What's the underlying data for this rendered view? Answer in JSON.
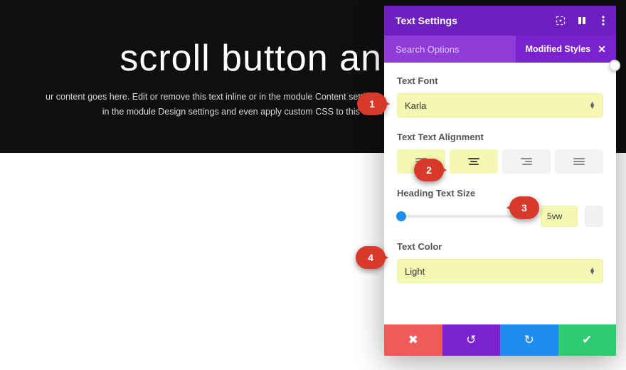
{
  "hero": {
    "title": "scroll button animation",
    "body": "ur content goes here. Edit or remove this text inline or in the module Content settings. You can also style every aspect of this content in the module Design settings and even apply custom CSS to this text in the module Advanced settings."
  },
  "panel": {
    "title": "Text Settings",
    "search_label": "Search Options",
    "modified_label": "Modified Styles"
  },
  "fields": {
    "font": {
      "label": "Text Font",
      "value": "Karla"
    },
    "align": {
      "label": "Text Text Alignment"
    },
    "size": {
      "label": "Heading Text Size",
      "value": "5vw"
    },
    "color": {
      "label": "Text Color",
      "value": "Light"
    }
  },
  "badges": {
    "b1": "1",
    "b2": "2",
    "b3": "3",
    "b4": "4"
  }
}
